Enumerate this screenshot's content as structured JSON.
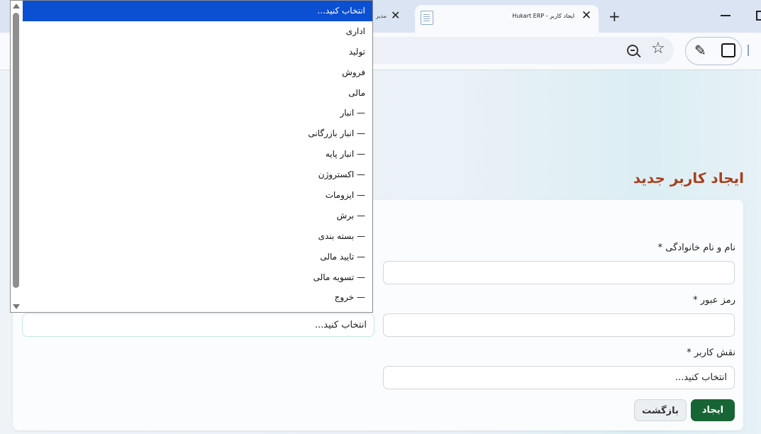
{
  "browser": {
    "inactive_tab_title": "مدیر",
    "active_tab_title": "ایجاد کاربر - Hukart ERP",
    "close_glyph": "✕",
    "new_tab_glyph": "+"
  },
  "page": {
    "title": "ایجاد کاربر جدید",
    "fields": {
      "full_name_label": "نام و نام خانوادگی *",
      "full_name_value": "",
      "password_label": "رمز عبور *",
      "password_value": "",
      "role_label": "نقش کاربر *",
      "role_value": "انتخاب کنید...",
      "department_value": "انتخاب کنید..."
    },
    "buttons": {
      "create": "ایجاد",
      "back": "بازگشت"
    }
  },
  "dropdown": {
    "options": [
      {
        "label": "انتخاب کنید...",
        "selected": true
      },
      {
        "label": "اداری"
      },
      {
        "label": "تولید"
      },
      {
        "label": "فروش"
      },
      {
        "label": "مالی"
      },
      {
        "label": "— انبار"
      },
      {
        "label": "— انبار بازرگانی"
      },
      {
        "label": "— انبار پایه"
      },
      {
        "label": "— اکستروژن"
      },
      {
        "label": "— ایزومات"
      },
      {
        "label": "— برش"
      },
      {
        "label": "— بسته بندی"
      },
      {
        "label": "— تایید مالی"
      },
      {
        "label": "— تسویه مالی"
      },
      {
        "label": "— خروج"
      }
    ]
  },
  "icons": {
    "zoom": "zoom-out-icon",
    "bookmark": "star-icon",
    "extension_a": "eyedropper-icon",
    "extension_b": "puzzle-icon"
  },
  "colors": {
    "title": "#a8401c",
    "create_button": "#176534",
    "selected_option": "#0b4fd3"
  }
}
